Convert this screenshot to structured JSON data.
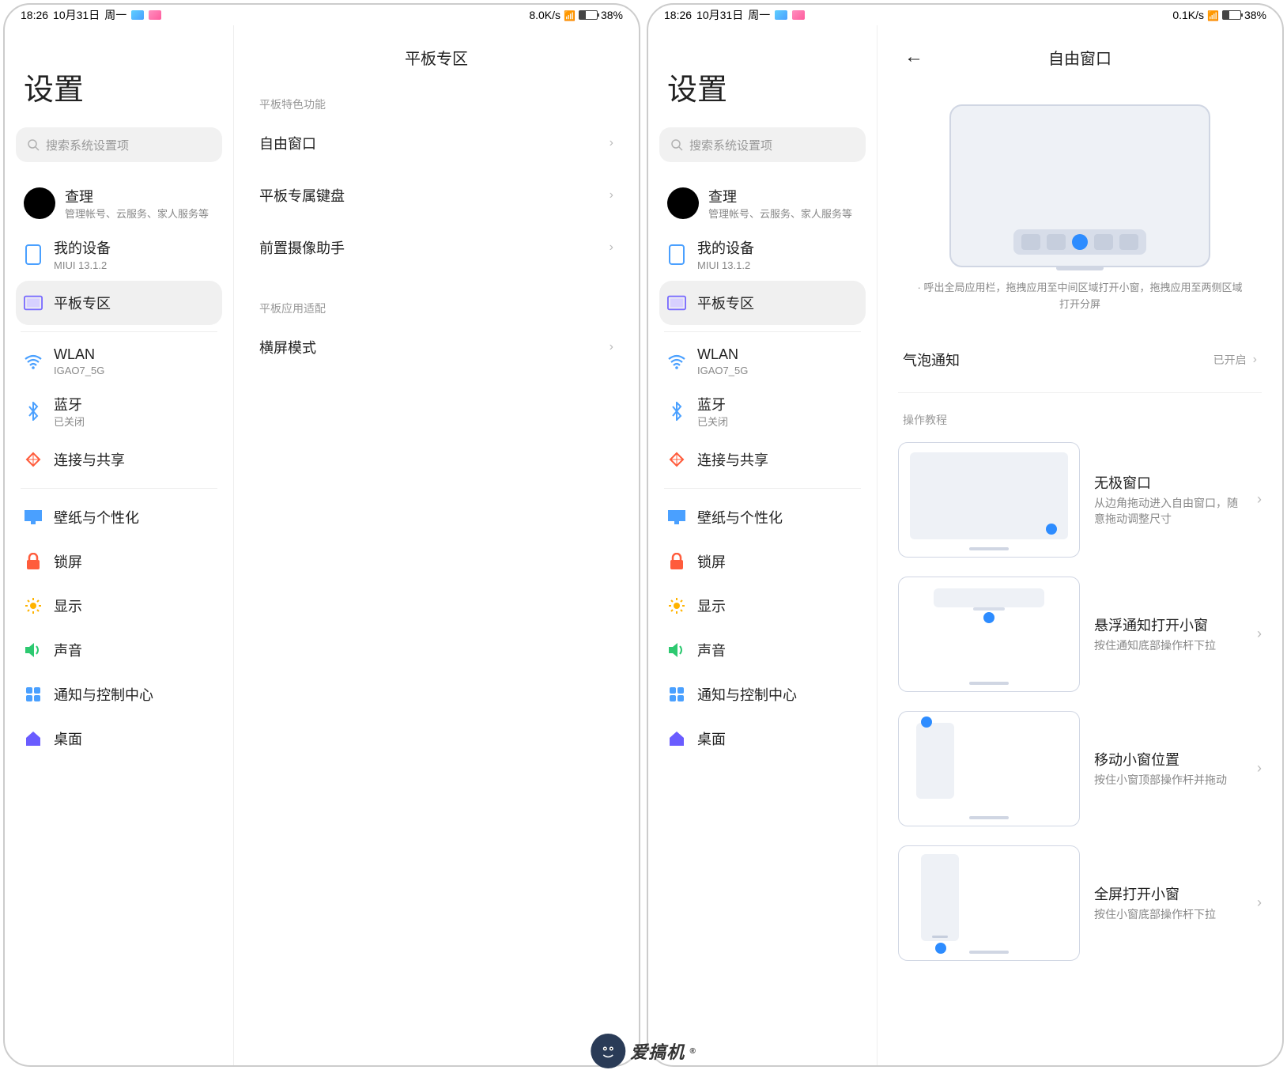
{
  "status": {
    "time": "18:26",
    "date": "10月31日",
    "weekday": "周一",
    "speed_left": "8.0K/s",
    "speed_right": "0.1K/s",
    "battery": "38%"
  },
  "sidebar": {
    "title": "设置",
    "search_placeholder": "搜索系统设置项",
    "account": {
      "name": "查理",
      "sub": "管理帐号、云服务、家人服务等"
    },
    "device": {
      "title": "我的设备",
      "sub": "MIUI 13.1.2"
    },
    "tablet": {
      "title": "平板专区"
    },
    "wlan": {
      "title": "WLAN",
      "sub": "IGAO7_5G"
    },
    "bt": {
      "title": "蓝牙",
      "sub": "已关闭"
    },
    "share": {
      "title": "连接与共享"
    },
    "wall": {
      "title": "壁纸与个性化"
    },
    "lock": {
      "title": "锁屏"
    },
    "display": {
      "title": "显示"
    },
    "sound": {
      "title": "声音"
    },
    "notif": {
      "title": "通知与控制中心"
    },
    "home": {
      "title": "桌面"
    }
  },
  "left_content": {
    "title": "平板专区",
    "sec1": "平板特色功能",
    "sec2": "平板应用适配",
    "rows": {
      "win": "自由窗口",
      "kb": "平板专属键盘",
      "cam": "前置摄像助手",
      "land": "横屏模式"
    }
  },
  "right_content": {
    "title": "自由窗口",
    "hint": "· 呼出全局应用栏，拖拽应用至中间区域打开小窗，拖拽应用至两侧区域打开分屏",
    "bubble": {
      "title": "气泡通知",
      "value": "已开启"
    },
    "sec": "操作教程",
    "tut1": {
      "t": "无极窗口",
      "s": "从边角拖动进入自由窗口，随意拖动调整尺寸"
    },
    "tut2": {
      "t": "悬浮通知打开小窗",
      "s": "按住通知底部操作杆下拉"
    },
    "tut3": {
      "t": "移动小窗位置",
      "s": "按住小窗顶部操作杆并拖动"
    },
    "tut4": {
      "t": "全屏打开小窗",
      "s": "按住小窗底部操作杆下拉"
    }
  },
  "watermark": "爱搞机"
}
